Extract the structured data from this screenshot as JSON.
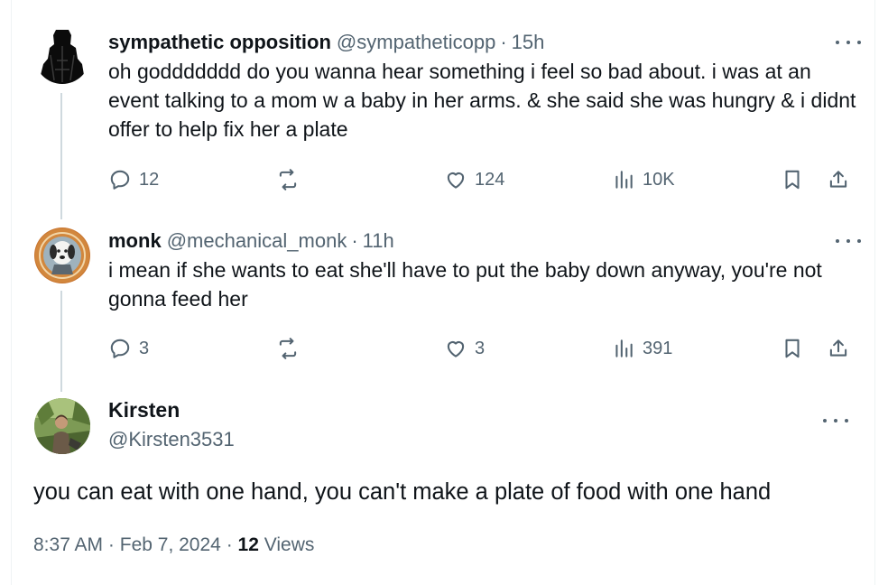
{
  "tweets": [
    {
      "name": "sympathetic opposition",
      "handle": "@sympatheticopp",
      "sep": "·",
      "time": "15h",
      "text": "oh goddddddd do you wanna hear something i feel so bad about. i was at an event talking to a mom w a baby in her arms. & she said she was hungry & i didnt offer to help fix her a plate",
      "replies": "12",
      "reposts": "",
      "likes": "124",
      "views": "10K"
    },
    {
      "name": "monk",
      "handle": "@mechanical_monk",
      "sep": "·",
      "time": "11h",
      "text": "i mean if she wants to eat she'll have to put the baby down anyway, you're not gonna feed her",
      "replies": "3",
      "reposts": "",
      "likes": "3",
      "views": "391"
    }
  ],
  "main": {
    "name": "Kirsten",
    "handle": "@Kirsten3531",
    "text": "you can eat with one hand, you can't make a plate of food with one hand",
    "time": "8:37 AM",
    "date": "Feb 7, 2024",
    "sep": "·",
    "views_count": "12",
    "views_label": "Views"
  },
  "icons": {
    "reply": "reply-icon",
    "repost": "repost-icon",
    "like": "heart-icon",
    "views": "views-chart-icon",
    "bookmark": "bookmark-icon",
    "share": "share-icon",
    "more": "more-dots-icon"
  },
  "colors": {
    "text": "#0f1419",
    "secondary": "#536471",
    "thread_line": "#cfd9de"
  }
}
